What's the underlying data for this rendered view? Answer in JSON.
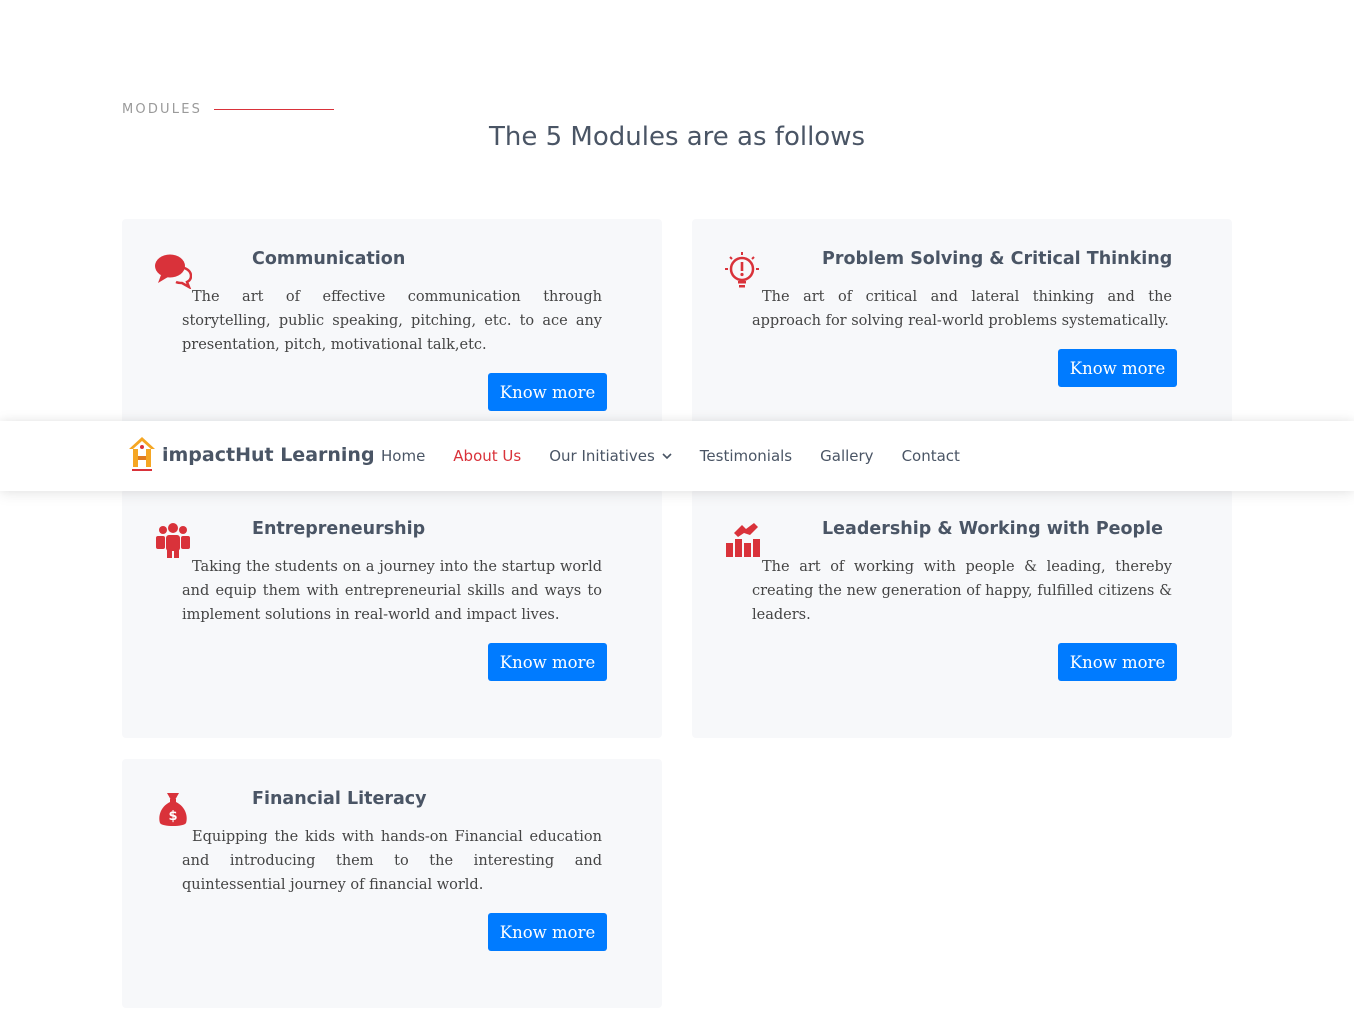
{
  "section": {
    "tag": "MODULES",
    "heading": "The 5 Modules are as follows"
  },
  "nav": {
    "brand": "impactHut Learning",
    "links": [
      "Home",
      "About Us",
      "Our Initiatives",
      "Testimonials",
      "Gallery",
      "Contact"
    ],
    "active": "About Us"
  },
  "modules": [
    {
      "icon": "speech-bubbles-icon",
      "title": "Communication",
      "description": "The art of effective communication through storytelling, public speaking, pitching, etc. to ace any presentation, pitch, motivational talk,etc.",
      "button": "Know more"
    },
    {
      "icon": "lightbulb-exclamation-icon",
      "title": "Problem Solving & Critical Thinking",
      "description": "The art of critical and lateral thinking and the approach for solving real-world problems systematically.",
      "button": "Know more"
    },
    {
      "icon": "people-group-icon",
      "title": "Entrepreneurship",
      "description": "Taking the students on a journey into the startup world and equip them with entrepreneurial skills and ways to implement solutions in real-world and impact lives.",
      "button": "Know more"
    },
    {
      "icon": "handshake-chart-icon",
      "title": "Leadership & Working with People",
      "description": "The art of working with people & leading, thereby creating the new generation of happy, fulfilled citizens & leaders.",
      "button": "Know more"
    },
    {
      "icon": "money-bag-icon",
      "title": "Financial Literacy",
      "description": "Equipping the kids with hands-on Financial education and introducing them to the interesting and quintessential journey of financial world.",
      "button": "Know more"
    }
  ],
  "colors": {
    "accent": "#d9323a",
    "button": "#007bff",
    "card_bg": "#f7f8fa",
    "heading": "#4a5565"
  }
}
